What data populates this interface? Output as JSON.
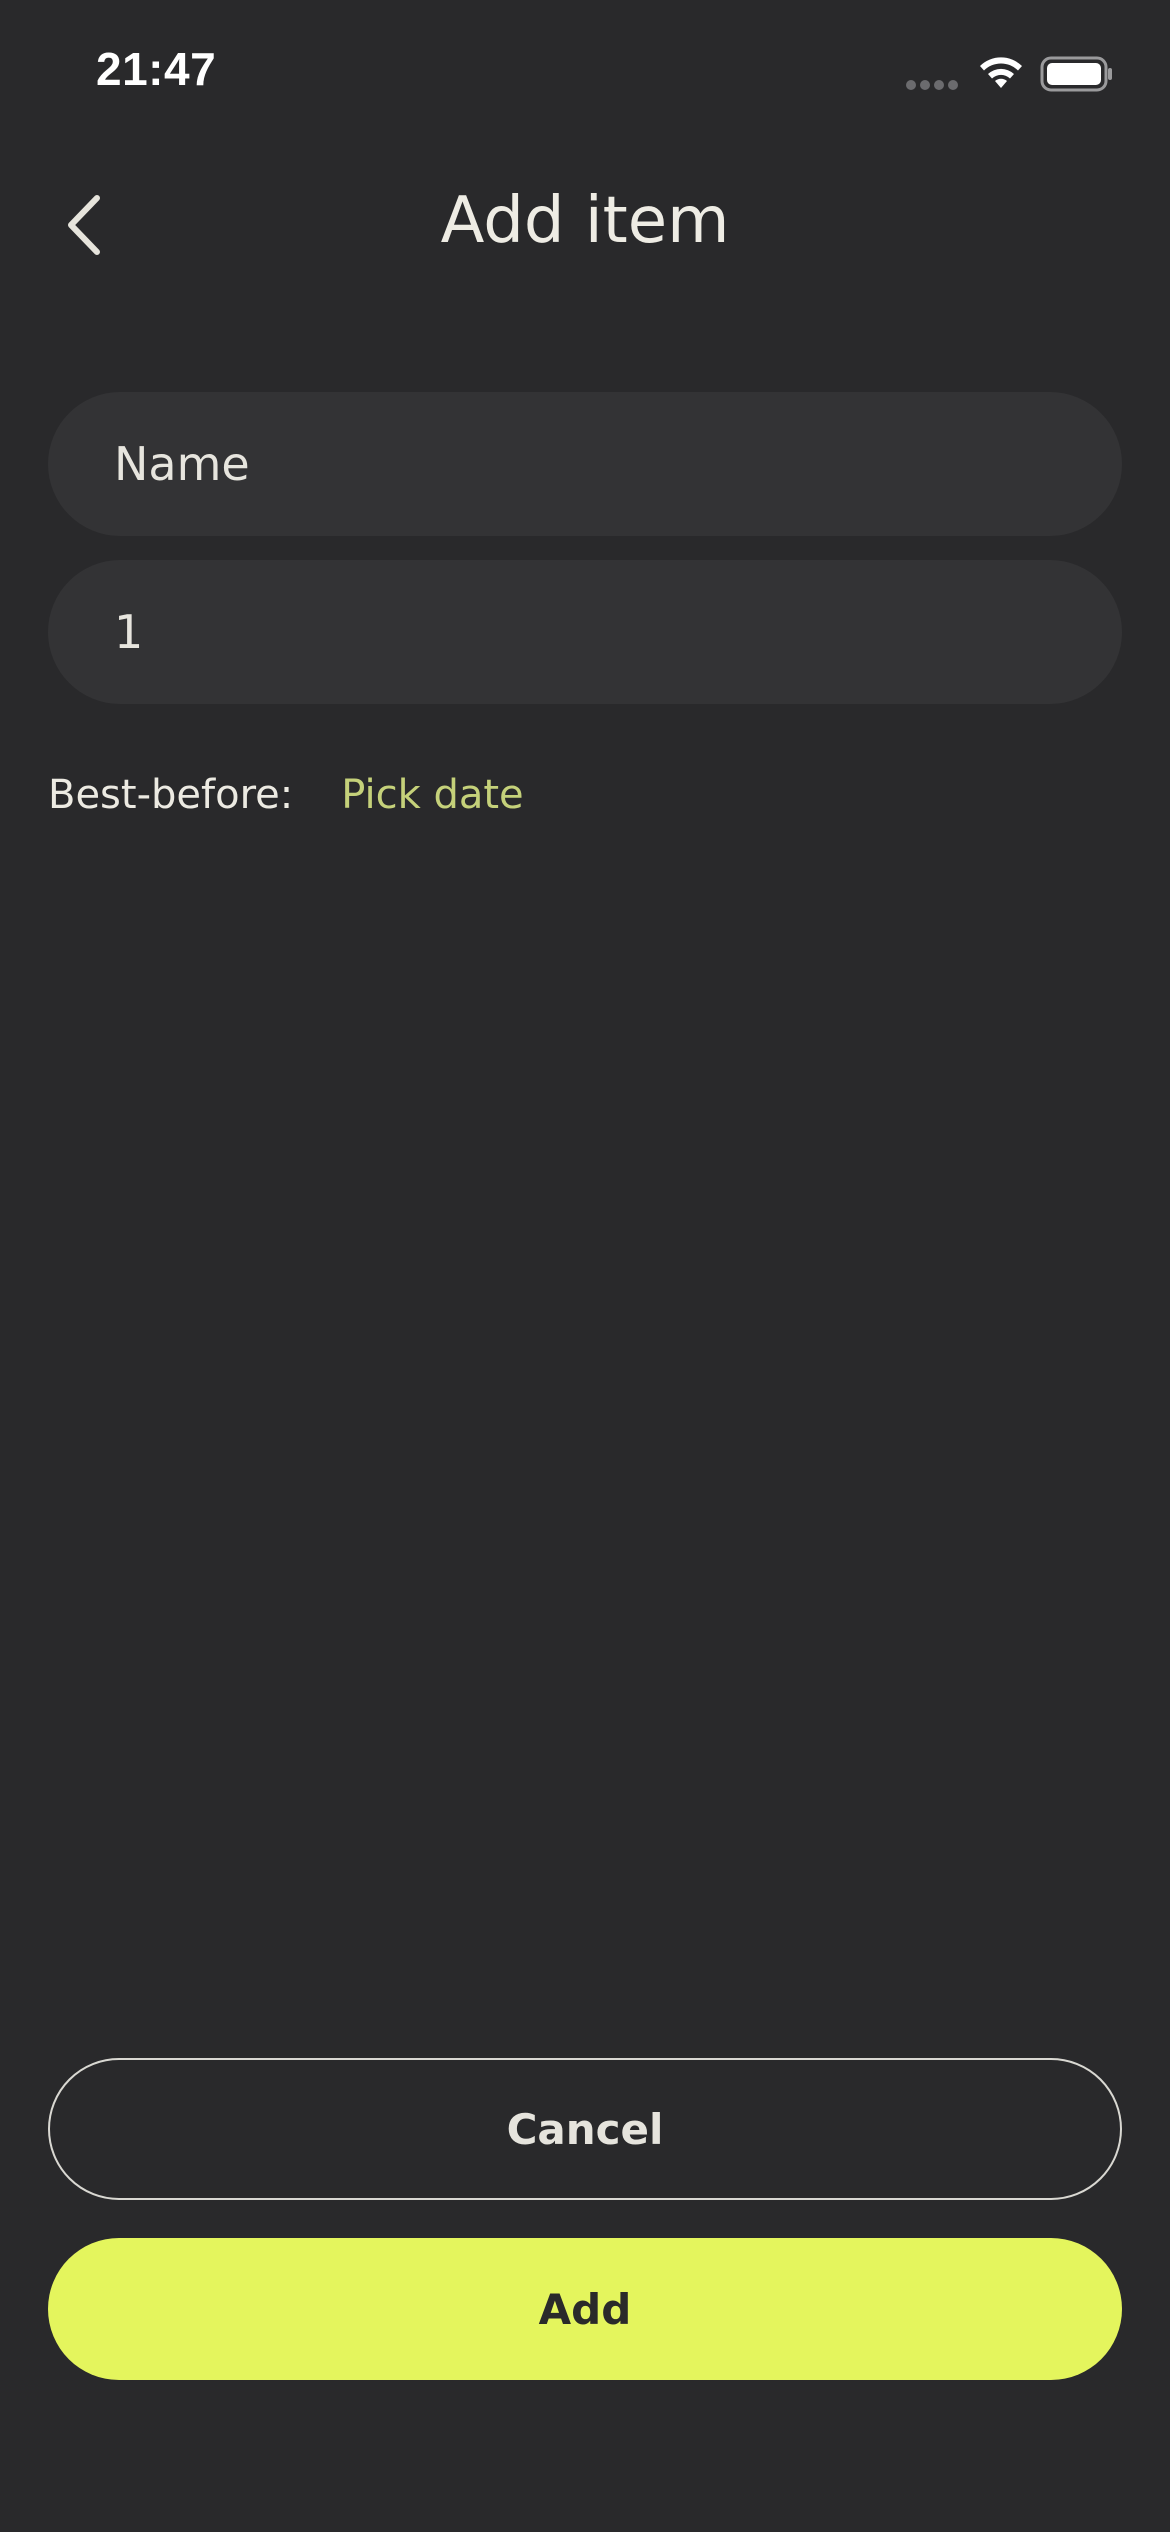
{
  "status_bar": {
    "time": "21:47"
  },
  "header": {
    "title": "Add item",
    "back_icon": "chevron-left-icon"
  },
  "form": {
    "name_placeholder": "Name",
    "name_value": "",
    "quantity_value": "1",
    "best_before_label": "Best-before:",
    "pick_date_label": "Pick date"
  },
  "actions": {
    "cancel_label": "Cancel",
    "add_label": "Add"
  },
  "colors": {
    "background": "#29292b",
    "field_background": "#333335",
    "accent": "#e4f55d",
    "link": "#c5d17a",
    "text": "#eceae2"
  }
}
